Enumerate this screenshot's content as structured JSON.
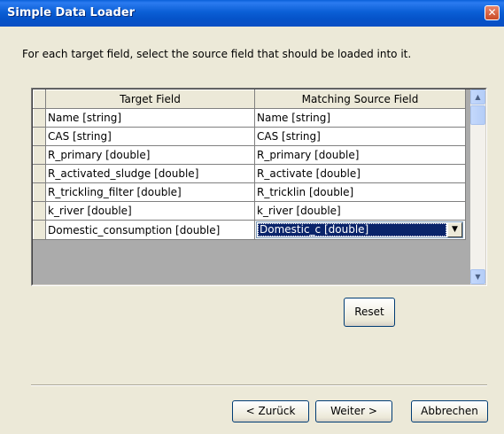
{
  "window": {
    "title": "Simple Data Loader",
    "close_glyph": "✕"
  },
  "instruction": "For each target field, select the source field that should be loaded into it.",
  "grid": {
    "headers": {
      "target": "Target Field",
      "source": "Matching Source Field"
    },
    "rows": [
      {
        "target": "Name [string]",
        "source": "Name [string]"
      },
      {
        "target": "CAS [string]",
        "source": "CAS [string]"
      },
      {
        "target": "R_primary [double]",
        "source": "R_primary [double]"
      },
      {
        "target": "R_activated_sludge [double]",
        "source": "R_activate [double]"
      },
      {
        "target": "R_trickling_filter [double]",
        "source": "R_tricklin [double]"
      },
      {
        "target": "k_river [double]",
        "source": "k_river [double]"
      },
      {
        "target": "Domestic_consumption [double]",
        "source": "Domestic_c [double]"
      }
    ],
    "active_row": 6,
    "icons": {
      "scroll_up": "scroll-up-icon",
      "scroll_down": "scroll-down-icon",
      "dropdown": "chevron-down-icon"
    }
  },
  "buttons": {
    "reset": "Reset",
    "back": "< Zurück",
    "next": "Weiter >",
    "cancel": "Abbrechen"
  },
  "colors": {
    "titlebar": "#0553c9",
    "selection": "#0a246a",
    "dialog_bg": "#ece9d8"
  }
}
